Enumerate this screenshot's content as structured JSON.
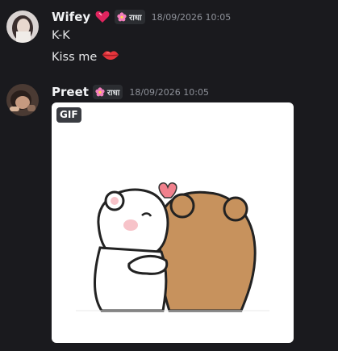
{
  "messages": [
    {
      "username": "Wifey",
      "username_emoji": "heart-icon",
      "role_tag": "राधा",
      "timestamp": "18/09/2026 10:05",
      "lines": [
        "K-K",
        "Kiss me"
      ],
      "line_emoji": "lips-icon"
    },
    {
      "username": "Preet",
      "role_tag": "राधा",
      "timestamp": "18/09/2026 10:05",
      "attachment": {
        "type": "gif",
        "badge": "GIF"
      }
    }
  ],
  "colors": {
    "background": "#1a1a1e",
    "username": "#f2f3f5",
    "timestamp": "#8e9199",
    "role_tag_bg": "#2b2d31",
    "heart": "#e0245e",
    "flower": "#f47fbe"
  }
}
